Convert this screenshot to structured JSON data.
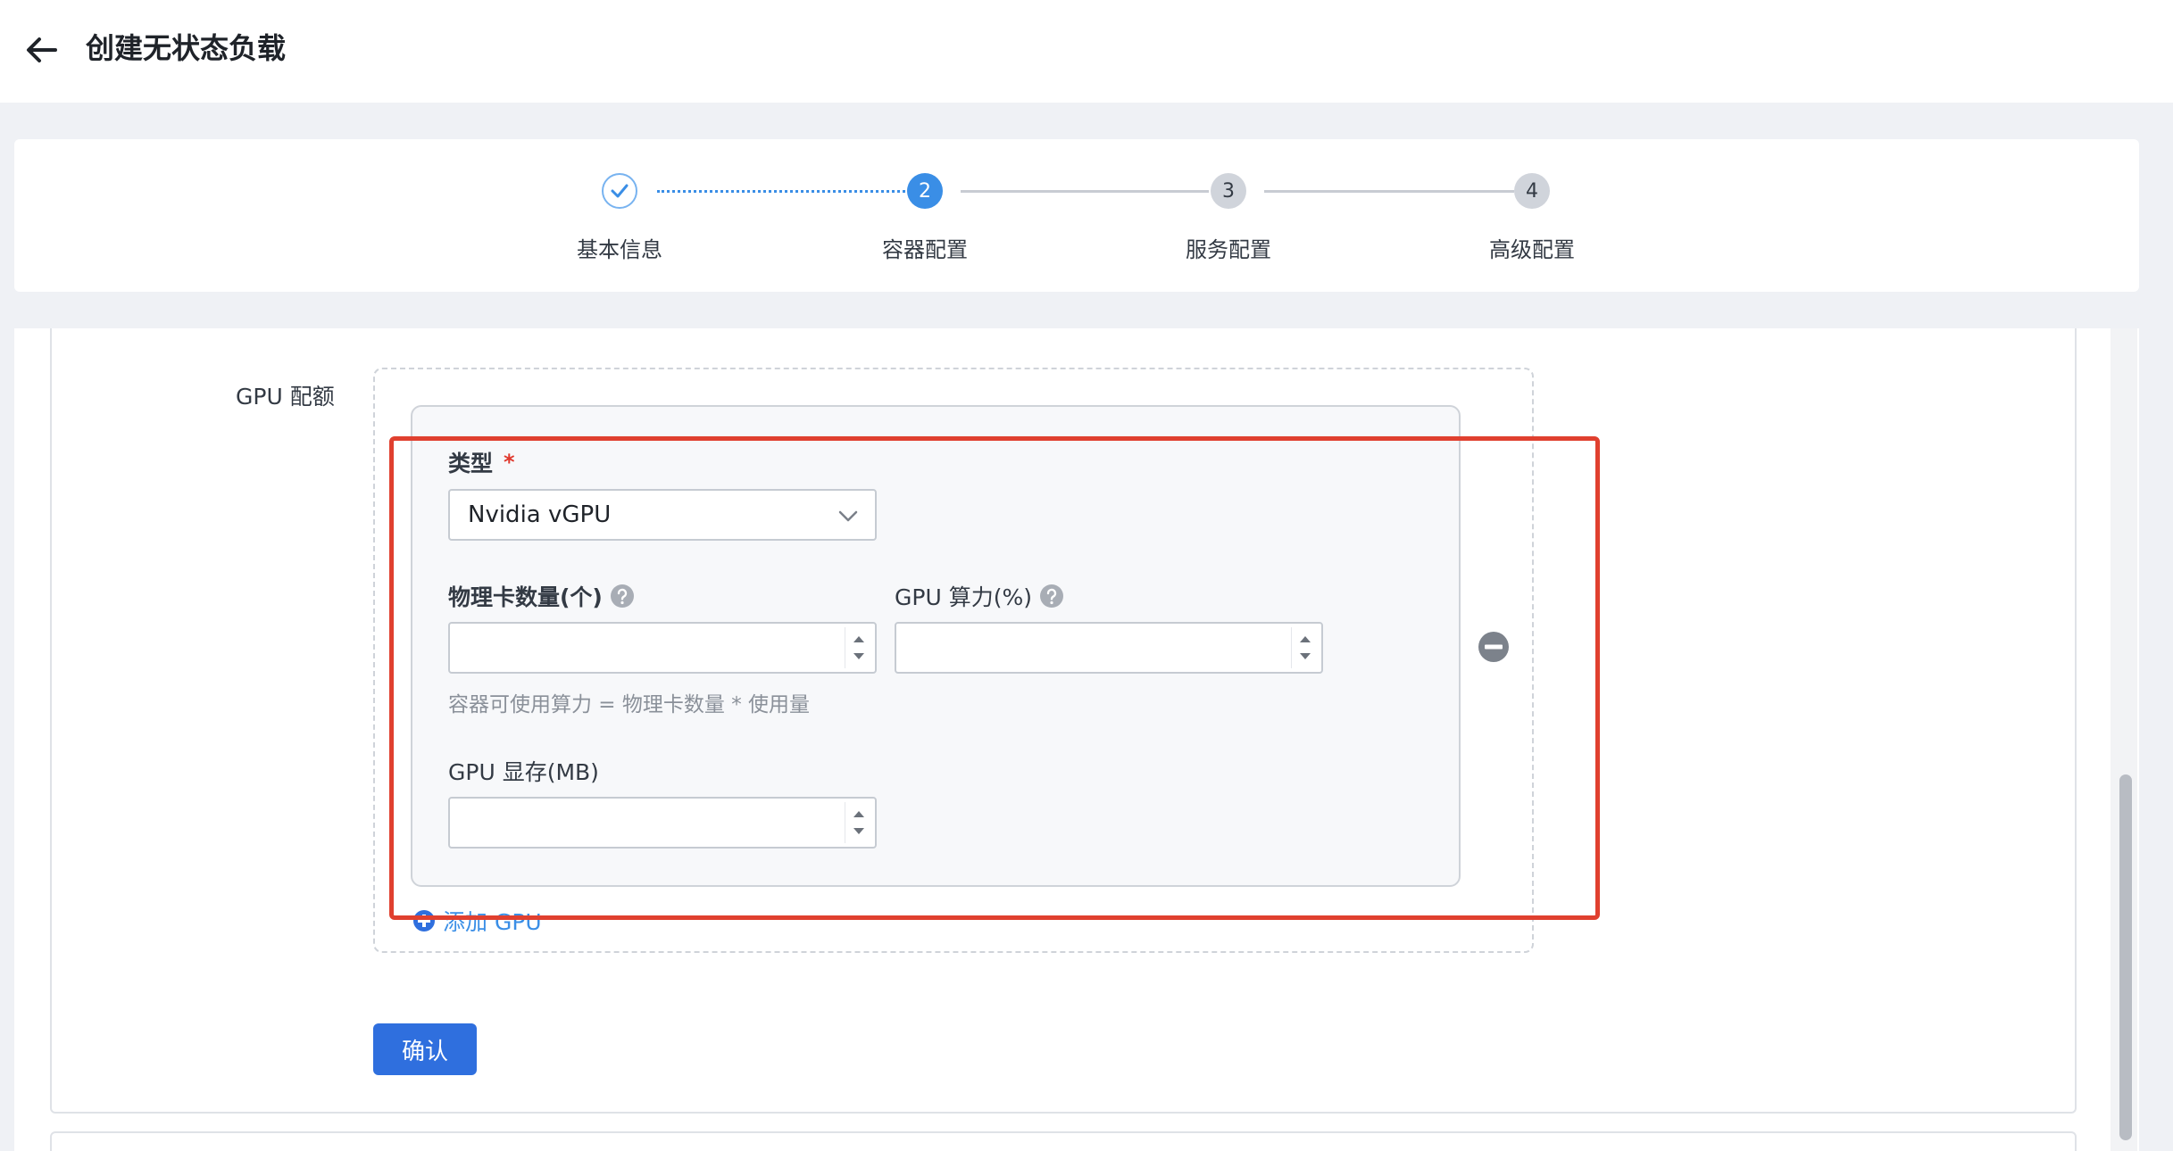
{
  "header": {
    "title": "创建无状态负载",
    "back_icon": "arrow-left-icon"
  },
  "steps": [
    {
      "number": "",
      "label": "基本信息",
      "status": "done"
    },
    {
      "number": "2",
      "label": "容器配置",
      "status": "active"
    },
    {
      "number": "3",
      "label": "服务配置",
      "status": "todo"
    },
    {
      "number": "4",
      "label": "高级配置",
      "status": "todo"
    }
  ],
  "form": {
    "gpu_quota_label": "GPU 配额",
    "gpu_item": {
      "type_label": "类型",
      "type_required_mark": "*",
      "type_value": "Nvidia vGPU",
      "physical_cards_label": "物理卡数量(个)",
      "physical_cards_value": "",
      "compute_label": "GPU 算力(%)",
      "compute_value": "",
      "hint": "容器可使用算力 = 物理卡数量 * 使用量",
      "memory_label": "GPU 显存(MB)",
      "memory_value": ""
    },
    "add_gpu_label": "添加 GPU",
    "confirm_label": "确认"
  },
  "colors": {
    "accent": "#3a8ee6",
    "primary_button": "#2f6fde",
    "highlight": "#e0402f",
    "required": "#e0382c"
  }
}
